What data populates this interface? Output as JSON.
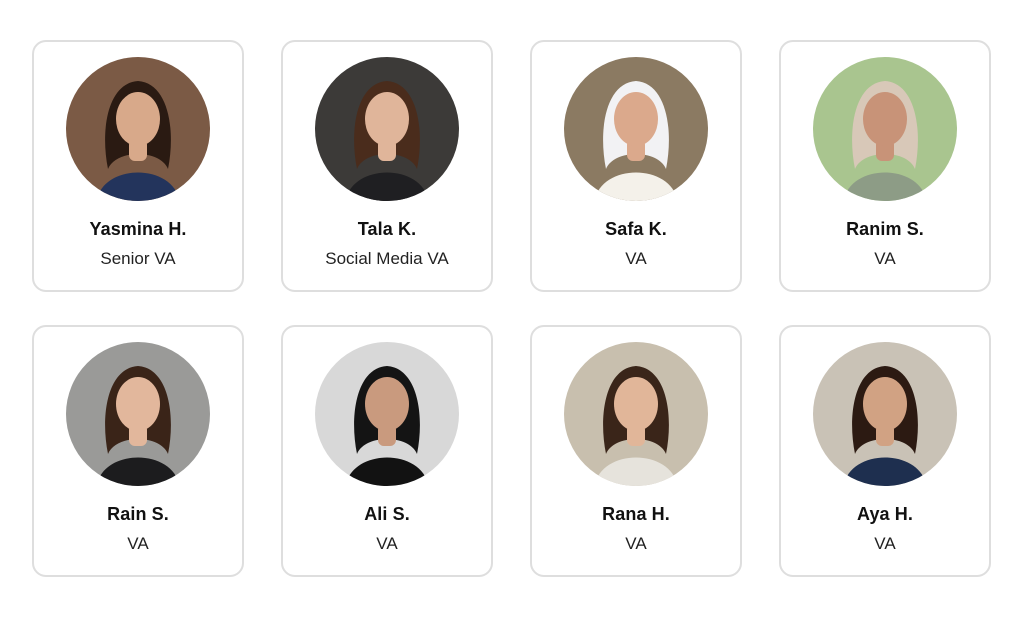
{
  "team": [
    {
      "name": "Yasmina H.",
      "role": "Senior VA",
      "photo_icon": "person-photo-icon",
      "bg": "#7b5a45",
      "hair": "#2a1a12",
      "skin": "#d8a98a",
      "top": "#23345c"
    },
    {
      "name": "Tala K.",
      "role": "Social Media VA",
      "photo_icon": "person-photo-icon",
      "bg": "#3c3a38",
      "hair": "#4a2c1c",
      "skin": "#e0b59a",
      "top": "#1f1f22"
    },
    {
      "name": "Safa K.",
      "role": "VA",
      "photo_icon": "person-photo-icon",
      "bg": "#8b7a62",
      "hair": "#f2f2f4",
      "skin": "#dba98c",
      "top": "#f4f1ea"
    },
    {
      "name": "Ranim S.",
      "role": "VA",
      "photo_icon": "person-photo-icon",
      "bg": "#a9c58f",
      "hair": "#d8c8b8",
      "skin": "#c89378",
      "top": "#8d9c86"
    },
    {
      "name": "Rain S.",
      "role": "VA",
      "photo_icon": "person-photo-icon",
      "bg": "#9a9a98",
      "hair": "#3a2418",
      "skin": "#e2b79c",
      "top": "#1c1c1e"
    },
    {
      "name": "Ali S.",
      "role": "VA",
      "photo_icon": "person-photo-icon",
      "bg": "#d8d8d8",
      "hair": "#141414",
      "skin": "#c99a7e",
      "top": "#121212"
    },
    {
      "name": "Rana H.",
      "role": "VA",
      "photo_icon": "person-photo-icon",
      "bg": "#c8bfae",
      "hair": "#3a2519",
      "skin": "#e1b699",
      "top": "#e6e3dc"
    },
    {
      "name": "Aya H.",
      "role": "VA",
      "photo_icon": "person-photo-icon",
      "bg": "#c9c2b6",
      "hair": "#2c1a12",
      "skin": "#d1a283",
      "top": "#1e2f4f"
    }
  ]
}
